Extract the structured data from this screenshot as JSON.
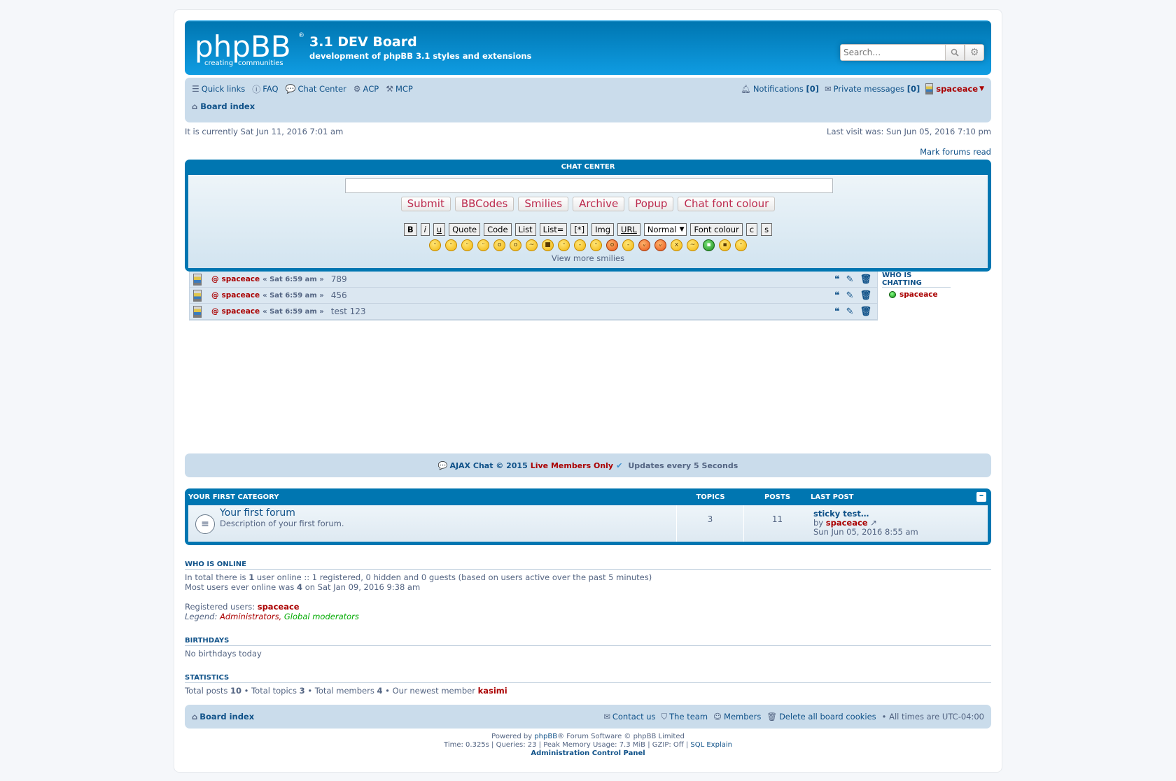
{
  "site": {
    "title": "3.1 DEV Board",
    "description": "development of phpBB 3.1 styles and extensions",
    "logo_main": "phpBB",
    "logo_sub1": "creating",
    "logo_sub2": "communities"
  },
  "search": {
    "placeholder": "Search…"
  },
  "nav": {
    "quick_links": "Quick links",
    "faq": "FAQ",
    "chat_center": "Chat Center",
    "acp": "ACP",
    "mcp": "MCP",
    "notifications": "Notifications",
    "notifications_count": "[0]",
    "private_messages": "Private messages",
    "pm_count": "[0]",
    "username": "spaceace",
    "board_index": "Board index"
  },
  "info": {
    "current_time": "It is currently Sat Jun 11, 2016 7:01 am",
    "last_visit": "Last visit was: Sun Jun 05, 2016 7:10 pm",
    "mark_read": "Mark forums read"
  },
  "chat": {
    "header": "CHAT CENTER",
    "buttons": [
      "Submit",
      "BBCodes",
      "Smilies",
      "Archive",
      "Popup",
      "Chat font colour"
    ],
    "bbcodes": [
      "B",
      "i",
      "u",
      "Quote",
      "Code",
      "List",
      "List=",
      "[*]",
      "Img",
      "URL"
    ],
    "size_select": "Normal",
    "font_colour": "Font colour",
    "extra_btns": [
      "c",
      "s"
    ],
    "smilies": [
      "😄",
      "😆",
      "😉",
      "😁",
      "😮",
      "😲",
      "😕",
      "😎",
      "😝",
      "😐",
      "😃",
      "😯",
      "😑",
      "😈",
      "👿",
      "😵",
      "😒",
      "😷",
      "😜"
    ],
    "view_more": "View more smilies",
    "messages": [
      {
        "at": "@",
        "user": "spaceace",
        "time": "« Sat 6:59 am »",
        "text": "789"
      },
      {
        "at": "@",
        "user": "spaceace",
        "time": "« Sat 6:59 am »",
        "text": "456"
      },
      {
        "at": "@",
        "user": "spaceace",
        "time": "« Sat 6:59 am »",
        "text": "test 123"
      }
    ],
    "who_chatting_title": "WHO IS CHATTING",
    "who_chatting_user": "spaceace",
    "footer_left": "AJAX Chat © 2015",
    "footer_red": "Live Members Only",
    "footer_right": "Updates every 5 Seconds"
  },
  "forums": {
    "category": "YOUR FIRST CATEGORY",
    "col_topics": "TOPICS",
    "col_posts": "POSTS",
    "col_last": "LAST POST",
    "row": {
      "title": "Your first forum",
      "description": "Description of your first forum.",
      "topics": "3",
      "posts": "11",
      "last_title": "sticky test…",
      "last_by": "by",
      "last_user": "spaceace",
      "last_date": "Sun Jun 05, 2016 8:55 am"
    }
  },
  "online": {
    "title": "WHO IS ONLINE",
    "line1_pre": "In total there is",
    "line1_num": "1",
    "line1_post": "user online :: 1 registered, 0 hidden and 0 guests (based on users active over the past 5 minutes)",
    "line2_pre": "Most users ever online was",
    "line2_num": "4",
    "line2_post": "on Sat Jan 09, 2016 9:38 am",
    "registered_label": "Registered users:",
    "registered_user": "spaceace",
    "legend_label": "Legend:",
    "legend_admin": "Administrators",
    "legend_mod": "Global moderators"
  },
  "birthdays": {
    "title": "BIRTHDAYS",
    "text": "No birthdays today"
  },
  "statistics": {
    "title": "STATISTICS",
    "posts_label": "Total posts",
    "posts": "10",
    "topics_label": "• Total topics",
    "topics": "3",
    "members_label": "• Total members",
    "members": "4",
    "newest_label": "• Our newest member",
    "newest": "kasimi"
  },
  "footer": {
    "board_index": "Board index",
    "contact": "Contact us",
    "team": "The team",
    "members": "Members",
    "delete_cookies": "Delete all board cookies",
    "times": "• All times are",
    "tz": "UTC-04:00",
    "powered_pre": "Powered by",
    "powered_link": "phpBB",
    "powered_post": "® Forum Software © phpBB Limited",
    "debug": "Time: 0.325s | Queries: 23 | Peak Memory Usage: 7.3 MiB | GZIP: Off |",
    "sql_explain": "SQL Explain",
    "acp": "Administration Control Panel"
  }
}
